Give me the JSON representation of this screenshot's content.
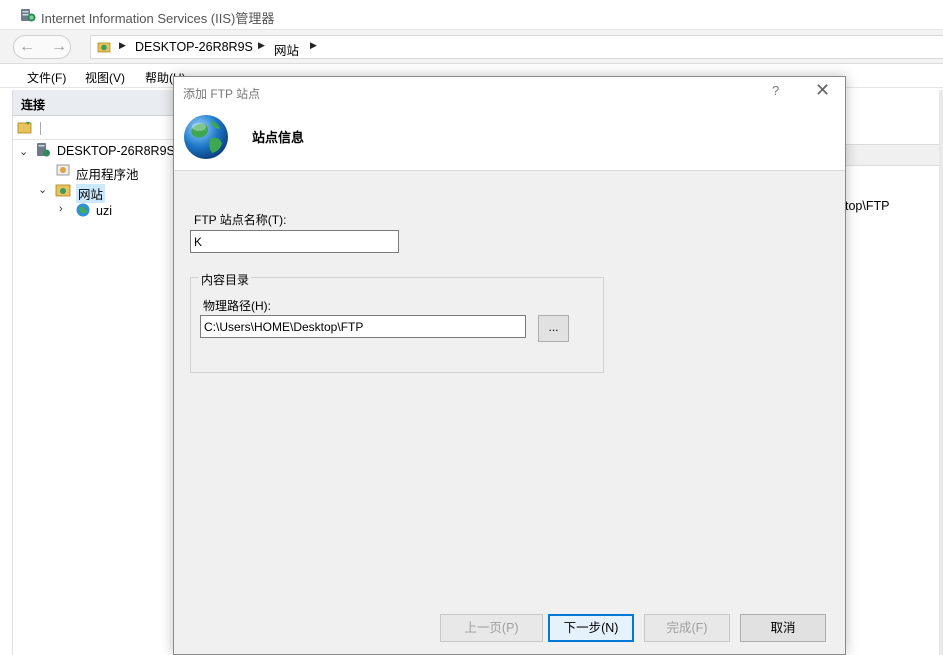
{
  "window": {
    "title": "Internet Information Services (IIS)管理器"
  },
  "address": {
    "crumbs": [
      "DESKTOP-26R8R9S",
      "网站"
    ]
  },
  "menu": {
    "file": "文件(F)",
    "view": "视图(V)",
    "help": "帮助(H)"
  },
  "connections": {
    "header": "连接",
    "tree": {
      "server": "DESKTOP-26R8R9S (",
      "app_pools": "应用程序池",
      "sites": "网站",
      "site_uzi": "uzi"
    }
  },
  "background": {
    "path_fragment": "top\\FTP"
  },
  "dialog": {
    "title": "添加 FTP 站点",
    "help_glyph": "?",
    "close_glyph": "✕",
    "heading": "站点信息",
    "site_name_label": "FTP 站点名称(T):",
    "site_name_value": "K",
    "content_dir_legend": "内容目录",
    "physical_path_label": "物理路径(H):",
    "physical_path_value": "C:\\Users\\HOME\\Desktop\\FTP",
    "browse_label": "...",
    "buttons": {
      "previous": "上一页(P)",
      "next": "下一步(N)",
      "finish": "完成(F)",
      "cancel": "取消"
    }
  },
  "icons": {
    "app": "iis-manager-icon",
    "globe": "globe-icon",
    "server": "server-icon",
    "app_pool": "app-pool-icon",
    "sites_folder": "sites-folder-icon",
    "site": "site-globe-icon"
  },
  "colors": {
    "accent": "#0078d7",
    "dialog_bg": "#f0f0f0"
  }
}
